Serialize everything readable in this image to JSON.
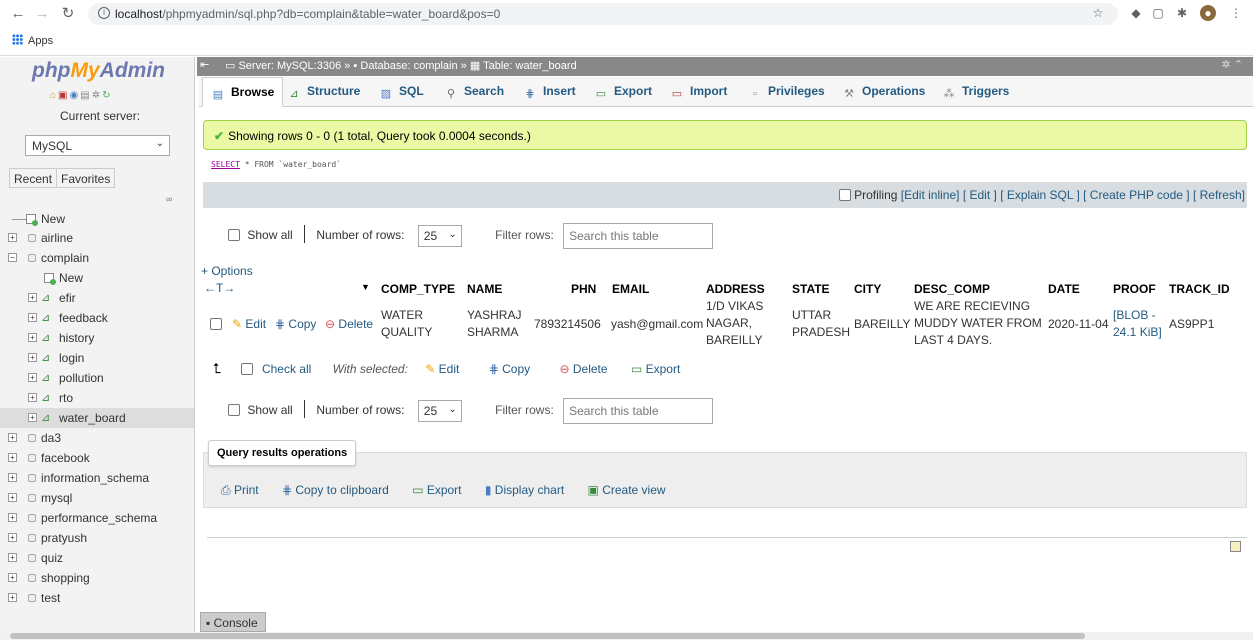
{
  "browser": {
    "url_host": "localhost",
    "url_path": "/phpmyadmin/sql.php?db=complain&table=water_board&pos=0",
    "bookmarks_apps": "Apps"
  },
  "sidebar": {
    "logo_php": "php",
    "logo_my": "My",
    "logo_admin": "Admin",
    "current_server_label": "Current server:",
    "server_value": "MySQL",
    "recent_label": "Recent",
    "favorites_label": "Favorites",
    "tree": {
      "new_root": "New",
      "databases": [
        "airline",
        "complain",
        "da3",
        "facebook",
        "information_schema",
        "mysql",
        "performance_schema",
        "pratyush",
        "quiz",
        "shopping",
        "test"
      ],
      "complain_children": [
        "New",
        "efir",
        "feedback",
        "history",
        "login",
        "pollution",
        "rto",
        "water_board"
      ]
    }
  },
  "breadcrumb": {
    "server": "Server: MySQL:3306",
    "database": "Database: complain",
    "table": "Table: water_board"
  },
  "tabs": [
    "Browse",
    "Structure",
    "SQL",
    "Search",
    "Insert",
    "Export",
    "Import",
    "Privileges",
    "Operations",
    "Triggers"
  ],
  "success_message": "Showing rows 0 - 0 (1 total, Query took 0.0004 seconds.)",
  "sql": {
    "select": "SELECT",
    "rest": " * FROM `water_board`"
  },
  "profiling": {
    "label": "Profiling",
    "links": [
      "[Edit inline]",
      "[ Edit ]",
      "[ Explain SQL ]",
      "[ Create PHP code ]",
      "[ Refresh]"
    ]
  },
  "controls": {
    "show_all": "Show all",
    "number_of_rows_label": "Number of rows:",
    "number_of_rows_value": "25",
    "filter_rows_label": "Filter rows:",
    "filter_placeholder": "Search this table"
  },
  "options_link": "+ Options",
  "table": {
    "nav_arrows": "←T→",
    "columns": [
      "COMP_TYPE",
      "NAME",
      "PHN",
      "EMAIL",
      "ADDRESS",
      "STATE",
      "CITY",
      "DESC_COMP",
      "DATE",
      "PROOF",
      "TRACK_ID"
    ],
    "row": {
      "edit": "Edit",
      "copy": "Copy",
      "delete": "Delete",
      "comp_type": [
        "WATER",
        "QUALITY"
      ],
      "name": [
        "YASHRAJ",
        "SHARMA"
      ],
      "phn": "7893214506",
      "email": "yash@gmail.com",
      "address": [
        "1/D VIKAS",
        "NAGAR,",
        "BAREILLY"
      ],
      "state": [
        "UTTAR",
        "PRADESH"
      ],
      "city": "BAREILLY",
      "desc_comp": [
        "WE ARE RECIEVING",
        "MUDDY WATER FROM",
        "LAST 4 DAYS."
      ],
      "date": "2020-11-04",
      "proof": [
        "[BLOB -",
        "24.1 KiB]"
      ],
      "track_id": "AS9PP1"
    }
  },
  "with_selected": {
    "check_all": "Check all",
    "label": "With selected:",
    "edit": "Edit",
    "copy": "Copy",
    "delete": "Delete",
    "export": "Export"
  },
  "query_ops": {
    "title": "Query results operations",
    "links": [
      "Print",
      "Copy to clipboard",
      "Export",
      "Display chart",
      "Create view"
    ]
  },
  "console_label": "Console"
}
